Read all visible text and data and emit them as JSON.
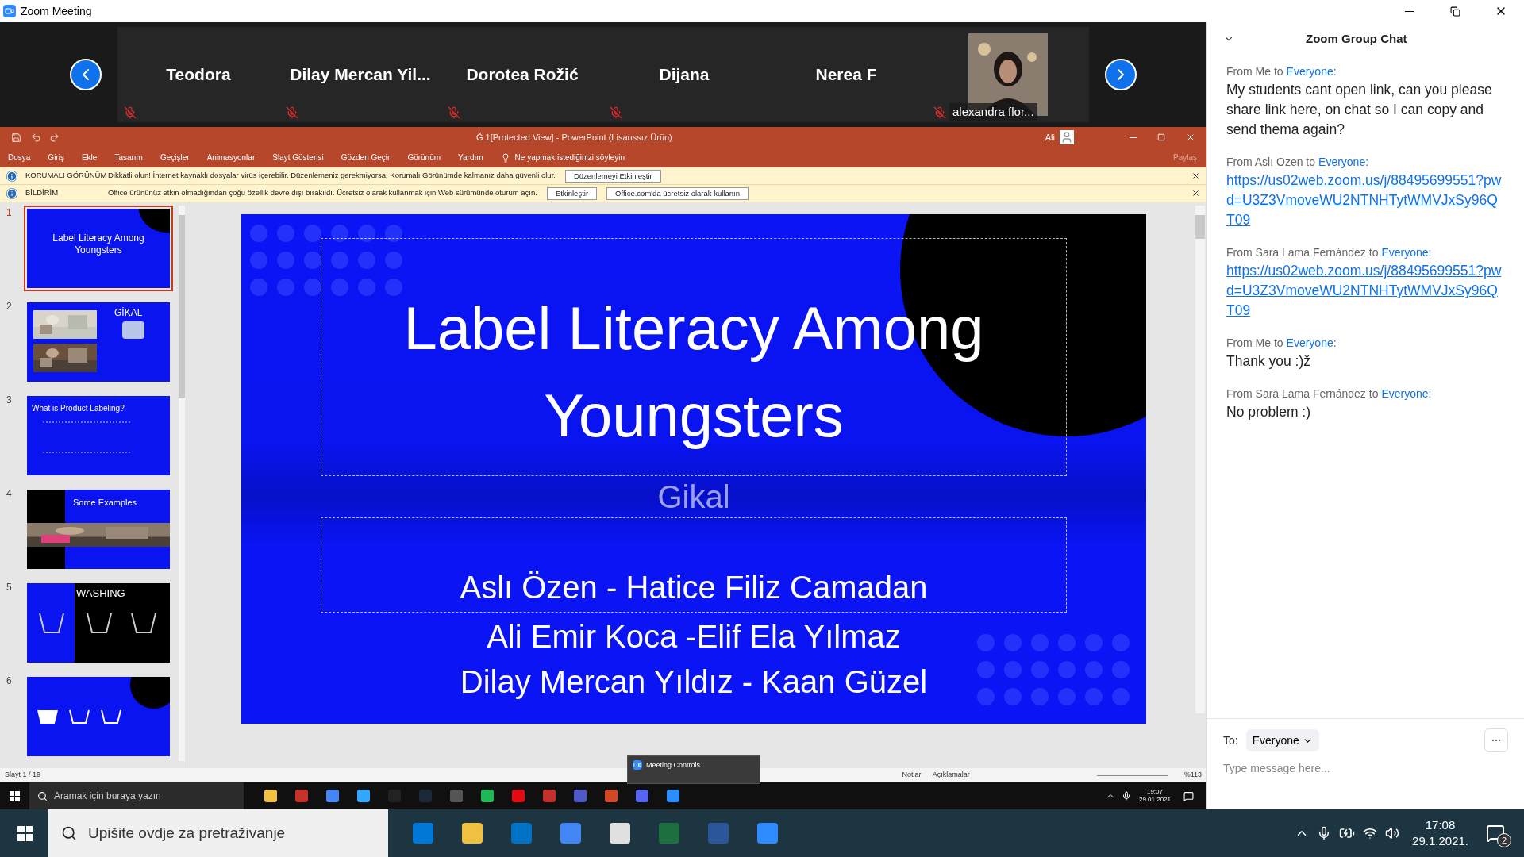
{
  "window": {
    "title": "Zoom Meeting"
  },
  "participants": [
    {
      "name": "Teodora",
      "kind": "name",
      "muted": true
    },
    {
      "name": "Dilay  Mercan  Yil...",
      "kind": "name",
      "muted": true
    },
    {
      "name": "Dorotea Rožić",
      "kind": "name",
      "muted": true
    },
    {
      "name": "Dijana",
      "kind": "name",
      "muted": true
    },
    {
      "name": "Nerea F",
      "kind": "name",
      "muted": false
    },
    {
      "name": "alexandra flor...",
      "kind": "video",
      "muted": true
    }
  ],
  "powerpoint": {
    "title": "Ğ 1[Protected View]  -  PowerPoint (Lisanssız Ürün)",
    "user": "Ali",
    "share": "Paylaş",
    "menu": [
      "Dosya",
      "Giriş",
      "Ekle",
      "Tasarım",
      "Geçişler",
      "Animasyonlar",
      "Slayt Gösterisi",
      "Gözden Geçir",
      "Görünüm",
      "Yardım"
    ],
    "tell_me": "Ne yapmak istediğinizi söyleyin",
    "notices": [
      {
        "label": "KORUMALI GÖRÜNÜM",
        "message": "Dikkatli olun! İnternet kaynaklı dosyalar virüs içerebilir. Düzenlemeniz gerekmiyorsa, Korumalı Görünümde kalmanız daha güvenli olur.",
        "buttons": [
          "Düzenlemeyi Etkinleştir"
        ]
      },
      {
        "label": "BİLDİRİM",
        "message": "Office ürününüz etkin olmadığından çoğu özellik devre dışı bırakıldı. Ücretsiz olarak kullanmak için Web sürümünde oturum açın.",
        "buttons": [
          "Etkinleştir",
          "Office.com'da ücretsiz olarak kullanın"
        ]
      }
    ],
    "thumbnails": [
      {
        "number": "1",
        "selected": true,
        "kind": "title",
        "text": "Label Literacy Among Youngsters"
      },
      {
        "number": "2",
        "selected": false,
        "kind": "photos",
        "text": "GİKAL"
      },
      {
        "number": "3",
        "selected": false,
        "kind": "text",
        "text": "What is Product Labeling?"
      },
      {
        "number": "4",
        "selected": false,
        "kind": "examples",
        "text": "Some Examples"
      },
      {
        "number": "5",
        "selected": false,
        "kind": "washing",
        "text": "WASHING"
      },
      {
        "number": "6",
        "selected": false,
        "kind": "icons"
      }
    ],
    "slide": {
      "title": "Label Literacy Among Youngsters",
      "subtitle": "Gikal",
      "authors": [
        "Aslı Özen - Hatice Filiz Camadan",
        "Ali Emir Koca -Elif Ela Yılmaz",
        "Dilay Mercan Yıldız - Kaan Güzel"
      ]
    },
    "status": {
      "slide_count": "Slayt 1 / 19",
      "notes": "Notlar",
      "comments": "Açıklamalar",
      "zoom": "%113"
    }
  },
  "meeting_controls": {
    "label": "Meeting Controls"
  },
  "inner_taskbar": {
    "search_placeholder": "Aramak için buraya yazın",
    "time": "19:07",
    "date": "29.01.2021"
  },
  "chat": {
    "title": "Zoom Group Chat",
    "messages": [
      {
        "from": "From Me to",
        "to": "Everyone:",
        "kind": "text",
        "text": "My students cant open link, can you please share link here, on chat so I can copy and send thema again?"
      },
      {
        "from": "From Aslı Ozen to",
        "to": "Everyone:",
        "kind": "link",
        "text": "https://us02web.zoom.us/j/88495699551?pwd=U3Z3VmoveWU2NTNHTytWMVJxSy96QT09"
      },
      {
        "from": "From Sara Lama Fernández to",
        "to": "Everyone:",
        "kind": "link",
        "text": "https://us02web.zoom.us/j/88495699551?pwd=U3Z3VmoveWU2NTNHTytWMVJxSy96QT09"
      },
      {
        "from": "From Me to",
        "to": "Everyone:",
        "kind": "text",
        "text": "Thank you :)ž"
      },
      {
        "from": "From Sara Lama Fernández to",
        "to": "Everyone:",
        "kind": "text",
        "text": "No problem :)"
      }
    ],
    "to_label": "To:",
    "recipient": "Everyone",
    "placeholder": "Type message here..."
  },
  "taskbar": {
    "search_placeholder": "Upišite ovdje za pretraživanje",
    "time": "17:08",
    "date": "29.1.2021.",
    "notifications": "2"
  }
}
